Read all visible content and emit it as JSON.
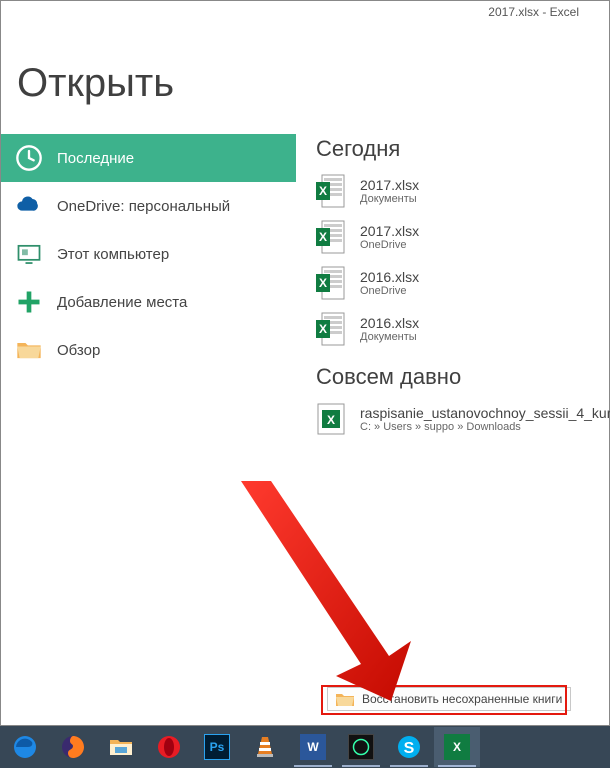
{
  "titlebar": "2017.xlsx - Excel",
  "page_title": "Открыть",
  "sidebar": {
    "items": [
      {
        "label": "Последние"
      },
      {
        "label": "OneDrive: персональный"
      },
      {
        "label": "Этот компьютер"
      },
      {
        "label": "Добавление места"
      },
      {
        "label": "Обзор"
      }
    ]
  },
  "groups": [
    {
      "heading": "Сегодня",
      "files": [
        {
          "name": "2017.xlsx",
          "path": "Документы"
        },
        {
          "name": "2017.xlsx",
          "path": "OneDrive"
        },
        {
          "name": "2016.xlsx",
          "path": "OneDrive"
        },
        {
          "name": "2016.xlsx",
          "path": "Документы"
        }
      ]
    },
    {
      "heading": "Совсем давно",
      "files": [
        {
          "name": "raspisanie_ustanovochnoy_sessii_4_kur",
          "path": "C: » Users » suppo » Downloads"
        }
      ]
    }
  ],
  "recover_button": "Восстановить несохраненные книги",
  "taskbar": {
    "items": [
      "edge",
      "firefox",
      "file-explorer",
      "opera",
      "photoshop",
      "vlc",
      "word",
      "mobaxterm",
      "skype",
      "excel"
    ]
  }
}
